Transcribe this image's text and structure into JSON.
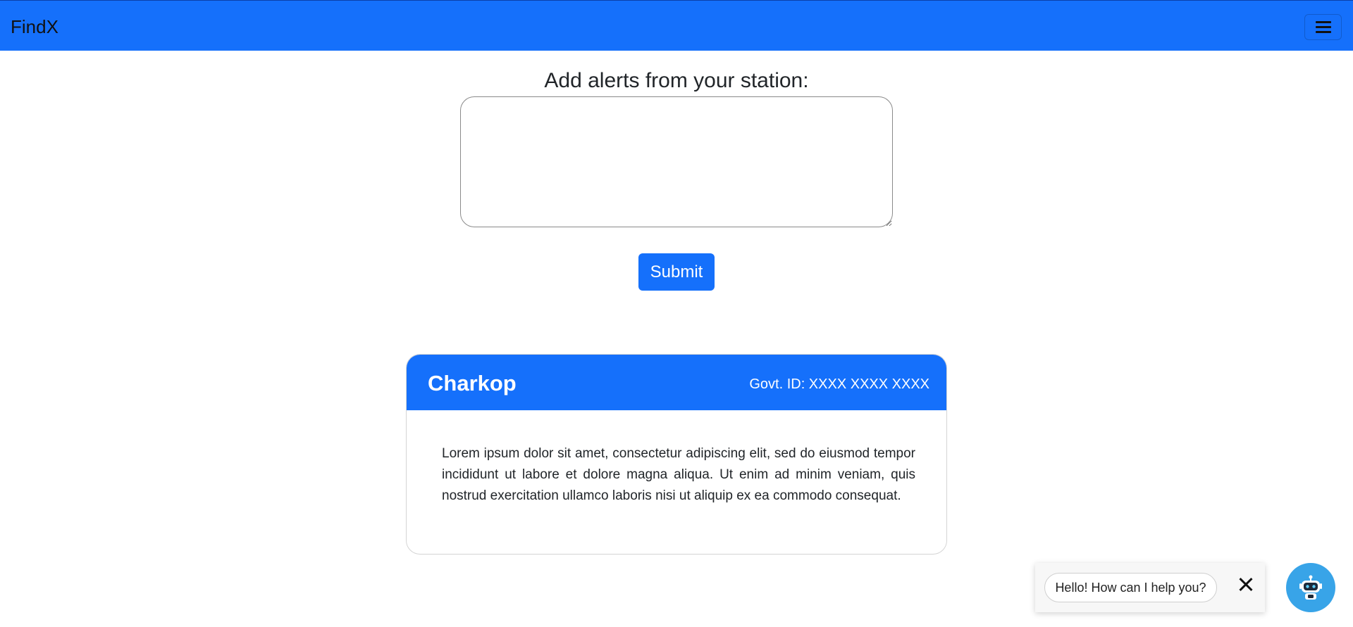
{
  "navbar": {
    "brand": "FindX",
    "menu_icon": "hamburger-menu-icon"
  },
  "alert_form": {
    "heading": "Add alerts from your station:",
    "textarea_value": "",
    "submit_label": "Submit"
  },
  "station_card": {
    "name": "Charkop",
    "gov_id": "Govt. ID: XXXX XXXX XXXX",
    "body": "Lorem ipsum dolor sit amet, consectetur adipiscing elit, sed do eiusmod tempor incididunt ut labore et dolore magna aliqua. Ut enim ad minim veniam, quis nostrud exercitation ullamco laboris nisi ut aliquip ex ea commodo consequat."
  },
  "chat_widget": {
    "greeting": "Hello! How can I help you?",
    "close_icon": "close-icon",
    "launcher_icon": "robot-icon"
  },
  "colors": {
    "primary": "#1570fb",
    "chat_launcher": "#38a4e8"
  }
}
